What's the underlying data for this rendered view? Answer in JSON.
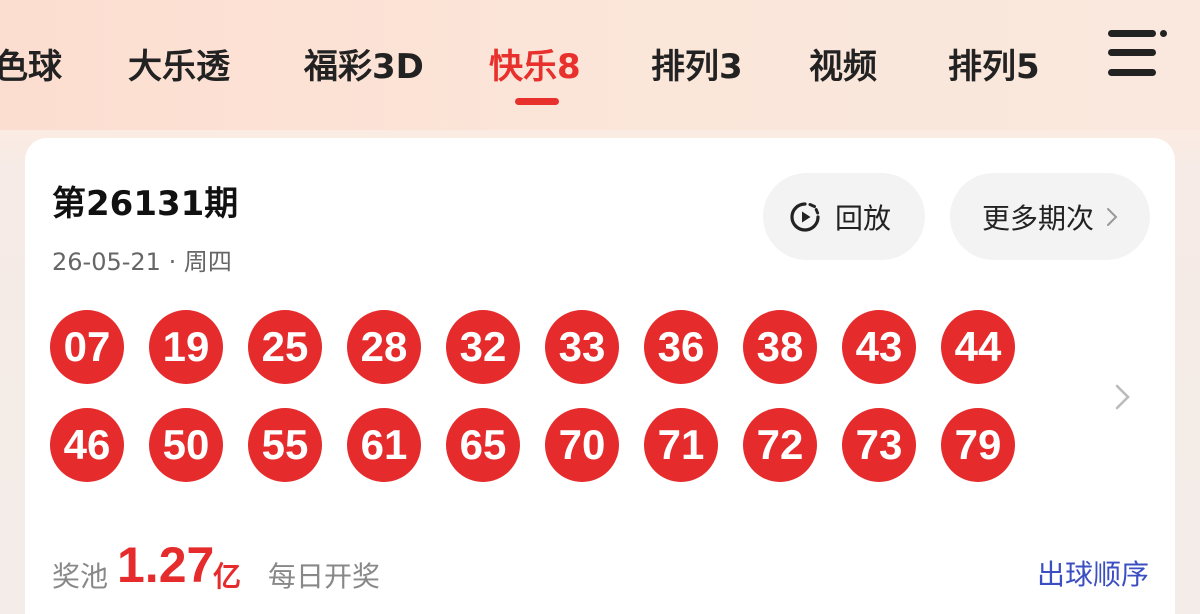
{
  "tabs": [
    {
      "label": "色球",
      "active": false
    },
    {
      "label": "大乐透",
      "active": false
    },
    {
      "label": "福彩3D",
      "active": false
    },
    {
      "label": "快乐8",
      "active": true
    },
    {
      "label": "排列3",
      "active": false
    },
    {
      "label": "视频",
      "active": false
    },
    {
      "label": "排列5",
      "active": false
    }
  ],
  "menu_icon": "hamburger-menu-icon",
  "draw": {
    "issue": "第26131期",
    "date": "26-05-21 · 周四",
    "replay_label": "回放",
    "more_label": "更多期次",
    "numbers_row1": [
      "07",
      "19",
      "25",
      "28",
      "32",
      "33",
      "36",
      "38",
      "43",
      "44"
    ],
    "numbers_row2": [
      "46",
      "50",
      "55",
      "61",
      "65",
      "70",
      "71",
      "72",
      "73",
      "79"
    ]
  },
  "pool": {
    "label": "奖池",
    "amount": "1.27",
    "unit": "亿",
    "schedule": "每日开奖"
  },
  "order_link": "出球顺序",
  "colors": {
    "accent": "#e8302c",
    "ball": "#e52b2b",
    "link": "#3b4fc2"
  }
}
